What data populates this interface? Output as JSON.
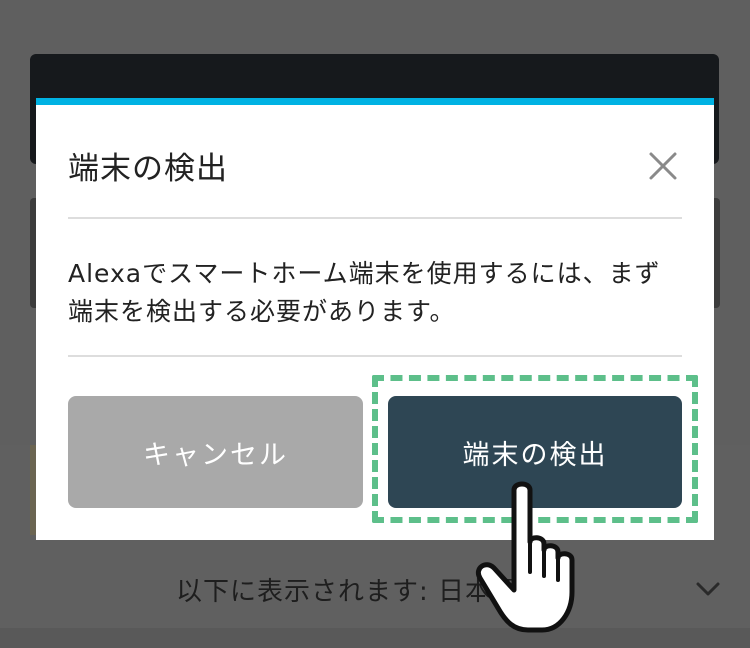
{
  "background": {
    "language_text": "以下に表示されます: 日本語 (JP)"
  },
  "dialog": {
    "title": "端末の検出",
    "message": "Alexaでスマートホーム端末を使用するには、まず端末を検出する必要があります。",
    "cancel_label": "キャンセル",
    "detect_label": "端末の検出",
    "close_icon": "close-icon"
  },
  "overlay": {
    "highlight_color": "#5dbf8a",
    "pointer_icon": "hand-pointer-icon"
  },
  "colors": {
    "accent": "#00b2e3",
    "primary_button": "#2e4654",
    "cancel_button": "#a9a9a9"
  }
}
